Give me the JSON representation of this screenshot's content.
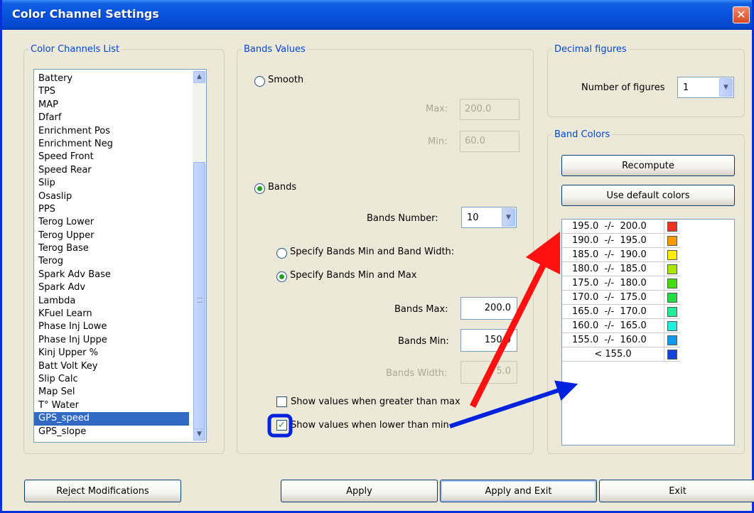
{
  "window": {
    "title": "Color Channel Settings",
    "close_glyph": "✕"
  },
  "channels": {
    "legend": "Color Channels List",
    "items": [
      "Battery",
      "TPS",
      "MAP",
      "Dfarf",
      "Enrichment Pos",
      "Enrichment Neg",
      "Speed Front",
      "Speed Rear",
      "Slip",
      "Osaslip",
      "PPS",
      "Terog Lower",
      "Terog Upper",
      "Terog Base",
      "Terog",
      "Spark Adv Base",
      "Spark Adv",
      "Lambda",
      "KFuel Learn",
      "Phase Inj Lowe",
      "Phase Inj Uppe",
      "Kinj Upper %",
      "Batt Volt Key",
      "Slip Calc",
      "Map Sel",
      "T° Water",
      "GPS_speed",
      "GPS_slope"
    ],
    "selected": "GPS_speed"
  },
  "bands_values": {
    "legend": "Bands Values",
    "smooth_label": "Smooth",
    "max_label": "Max:",
    "max_value": "200.0",
    "min_label": "Min:",
    "min_value": "60.0",
    "bands_label": "Bands",
    "bands_number_label": "Bands Number:",
    "bands_number_value": "10",
    "opt_width_label": "Specify Bands Min and Band Width:",
    "opt_max_label": "Specify Bands Min and Max",
    "bands_max_label": "Bands Max:",
    "bands_max_value": "200.0",
    "bands_min_label": "Bands Min:",
    "bands_min_value": "150.0",
    "bands_width_label": "Bands Width:",
    "bands_width_value": "5.0",
    "show_greater_label": "Show values when greater than max",
    "show_lower_label": "Show values when lower than min",
    "checkmark": "✓"
  },
  "decimal": {
    "legend": "Decimal figures",
    "number_label": "Number of figures",
    "number_value": "1"
  },
  "band_colors": {
    "legend": "Band Colors",
    "recompute_label": "Recompute",
    "default_label": "Use default colors",
    "rows": [
      {
        "label": "195.0  -/-  200.0",
        "color": "#ee3322"
      },
      {
        "label": "190.0  -/-  195.0",
        "color": "#ff9900"
      },
      {
        "label": "185.0  -/-  190.0",
        "color": "#ffee00"
      },
      {
        "label": "180.0  -/-  185.0",
        "color": "#a8e800"
      },
      {
        "label": "175.0  -/-  180.0",
        "color": "#44dd11"
      },
      {
        "label": "170.0  -/-  175.0",
        "color": "#22dd44"
      },
      {
        "label": "165.0  -/-  170.0",
        "color": "#22ee99"
      },
      {
        "label": "160.0  -/-  165.0",
        "color": "#22eedd"
      },
      {
        "label": "155.0  -/-  160.0",
        "color": "#1199ee"
      },
      {
        "label": "< 155.0",
        "color": "#1144dd"
      }
    ]
  },
  "buttons": {
    "reject": "Reject Modifications",
    "apply": "Apply",
    "apply_exit": "Apply and Exit",
    "exit": "Exit"
  },
  "colors": {
    "titlebar": "#0a53dc",
    "legend": "#0046d5",
    "selection": "#316ac5",
    "annotation_red": "#ff1111",
    "annotation_blue": "#0022dd"
  },
  "icons": {
    "close": "close-icon",
    "scroll_up": "chevron-up-icon",
    "scroll_down": "chevron-down-icon",
    "combo": "chevron-down-icon"
  }
}
